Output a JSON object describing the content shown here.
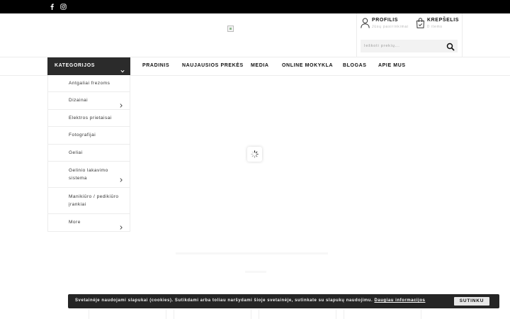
{
  "social": {
    "facebook_icon": "facebook-icon",
    "instagram_icon": "instagram-icon"
  },
  "header": {
    "profile": {
      "title": "PROFILIS",
      "subtitle": "Jūsų pasirinkimai"
    },
    "cart": {
      "title": "KREPŠELIS",
      "subtitle": "0 items"
    },
    "search": {
      "placeholder": "Ieškoti prekių..."
    }
  },
  "nav": {
    "categories_label": "KATEGORIJOS",
    "links": [
      "PRADINIS",
      "NAUJAUSIOS PREKĖS",
      "MEDIA",
      "ONLINE MOKYKLA",
      "BLOGAS",
      "APIE MUS"
    ]
  },
  "categories": [
    {
      "line1": "Antgaliai frezoms",
      "line2": "",
      "has_sub": false
    },
    {
      "line1": "Dizainai",
      "line2": "",
      "has_sub": true
    },
    {
      "line1": "Elektros prietaisai",
      "line2": "",
      "has_sub": false
    },
    {
      "line1": "Fotografijai",
      "line2": "",
      "has_sub": false
    },
    {
      "line1": "Geliai",
      "line2": "",
      "has_sub": false
    },
    {
      "line1": "Gelinio lakavimo",
      "line2": "sistema",
      "has_sub": true
    },
    {
      "line1": "Manikiūro / pedikiūro",
      "line2": "įrankiai",
      "has_sub": false
    },
    {
      "line1": "More",
      "line2": "",
      "has_sub": true
    }
  ],
  "cookie": {
    "message": "Svetainėje naudojami slapukai (cookies). Sutikdami arba toliau naršydami šioje svetainėje, sutinkate su slapukų naudojimu.",
    "link": "Daugiau informacijos",
    "button": "SUTINKU"
  },
  "colors": {
    "topbar": "#000000",
    "category_header": "#2b2b2b",
    "cookie_bg": "#252525"
  }
}
